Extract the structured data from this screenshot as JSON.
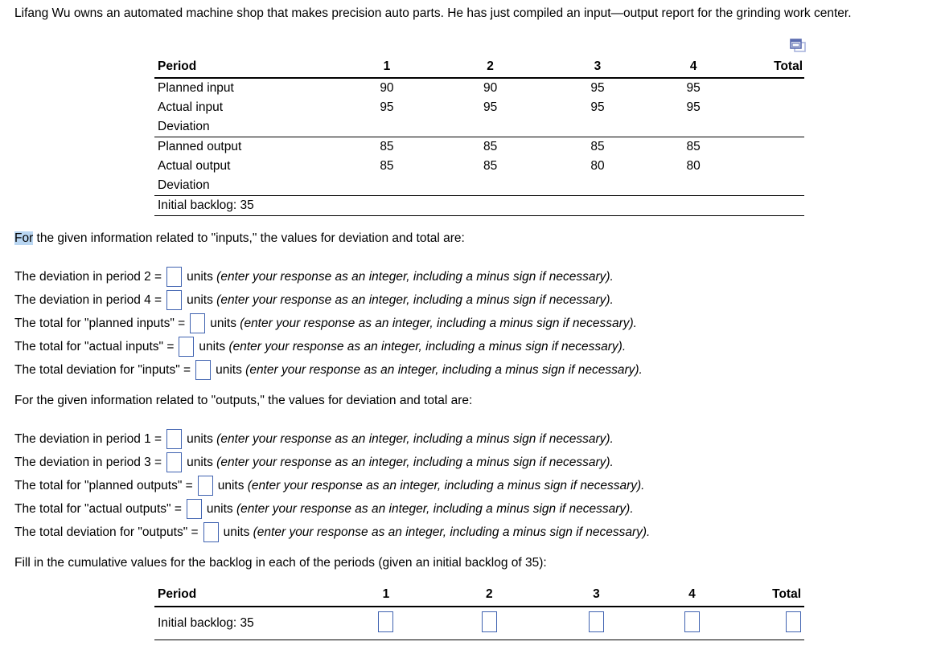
{
  "intro": {
    "text": "Lifang Wu owns an automated machine shop that makes precision auto parts. He has just compiled an input—output report for the grinding work center."
  },
  "icons": {
    "copy": "copy-windows-icon"
  },
  "colors": {
    "input_border": "#3f62b0",
    "highlight": "#b9d6f2",
    "icon_fill": "#5b6cb0",
    "icon_outline": "#a9b4dd",
    "rule": "#000000"
  },
  "report_table": {
    "headers": [
      "Period",
      "1",
      "2",
      "3",
      "4",
      "Total"
    ],
    "rows": [
      {
        "label": "Planned input",
        "values": [
          "90",
          "90",
          "95",
          "95"
        ],
        "total": ""
      },
      {
        "label": "Actual input",
        "values": [
          "95",
          "95",
          "95",
          "95"
        ],
        "total": ""
      },
      {
        "label": "Deviation",
        "values": [
          "",
          "",
          "",
          ""
        ],
        "total": ""
      },
      {
        "label": "Planned output",
        "values": [
          "85",
          "85",
          "85",
          "85"
        ],
        "total": ""
      },
      {
        "label": "Actual output",
        "values": [
          "85",
          "85",
          "80",
          "80"
        ],
        "total": ""
      },
      {
        "label": "Deviation",
        "values": [
          "",
          "",
          "",
          ""
        ],
        "total": ""
      },
      {
        "label": "Initial backlog: 35",
        "values": [
          "",
          "",
          "",
          ""
        ],
        "total": ""
      }
    ]
  },
  "inputs_section": {
    "heading_highlighted": "For",
    "heading_rest": " the given information related to \"inputs,\" the values for deviation and total are:",
    "hint": "(enter your response as an integer, including a minus sign if necessary).",
    "units": "units",
    "questions": [
      {
        "lead": "The deviation in period 2 ="
      },
      {
        "lead": "The deviation in period 4 ="
      },
      {
        "lead": "The total for \"planned inputs\"  ="
      },
      {
        "lead": "The total for \"actual inputs\" ="
      },
      {
        "lead": "The total deviation for \"inputs\" ="
      }
    ]
  },
  "outputs_section": {
    "heading": "For the given information related to \"outputs,\" the values for deviation and total are:",
    "hint": "(enter your response as an integer, including a minus sign if necessary).",
    "units": "units",
    "questions": [
      {
        "lead": "The deviation in period 1 ="
      },
      {
        "lead": "The deviation in period 3 ="
      },
      {
        "lead": "The total for \"planned outputs\"  ="
      },
      {
        "lead": "The total for \"actual outputs\" ="
      },
      {
        "lead": "The total deviation for \"outputs\" ="
      }
    ]
  },
  "backlog_section": {
    "instruction": "Fill in the cumulative values for the backlog in each of the periods (given an initial backlog of 35):",
    "headers": [
      "Period",
      "1",
      "2",
      "3",
      "4",
      "Total"
    ],
    "row_label": "Initial backlog: 35",
    "cell_values": [
      "",
      "",
      "",
      "",
      ""
    ]
  }
}
